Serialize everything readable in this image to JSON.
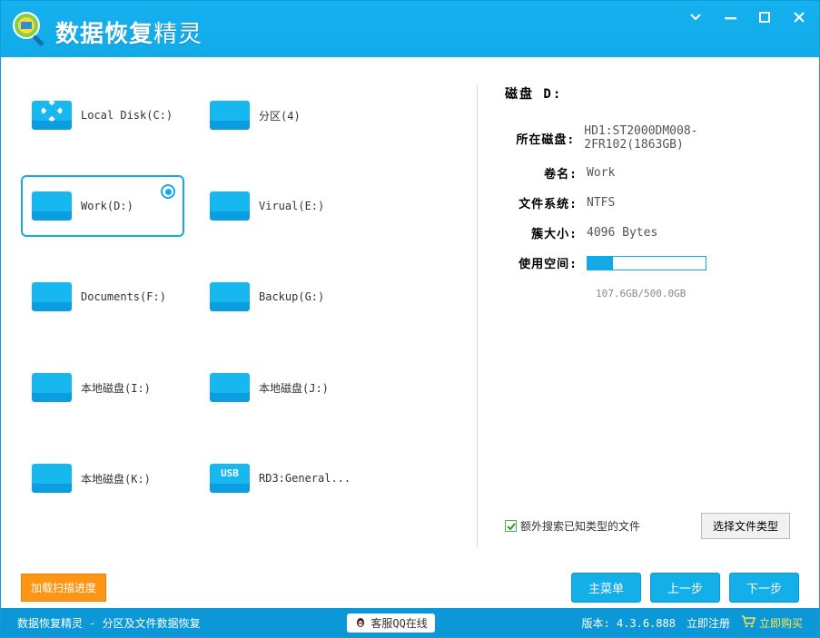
{
  "app_title_main": "数据恢复",
  "app_title_accent": "精灵",
  "disks": [
    {
      "label": "Local Disk(C:)",
      "kind": "system",
      "selected": false
    },
    {
      "label": "分区(4)",
      "kind": "partition",
      "selected": false
    },
    {
      "label": "Work(D:)",
      "kind": "disk",
      "selected": true
    },
    {
      "label": "Virual(E:)",
      "kind": "disk",
      "selected": false
    },
    {
      "label": "Documents(F:)",
      "kind": "disk",
      "selected": false
    },
    {
      "label": "Backup(G:)",
      "kind": "disk",
      "selected": false
    },
    {
      "label": "本地磁盘(I:)",
      "kind": "disk",
      "selected": false
    },
    {
      "label": "本地磁盘(J:)",
      "kind": "disk",
      "selected": false
    },
    {
      "label": "本地磁盘(K:)",
      "kind": "disk",
      "selected": false
    },
    {
      "label": "RD3:General...",
      "kind": "usb",
      "selected": false
    }
  ],
  "details": {
    "title": "磁盘 D:",
    "rows": {
      "physical_disk": {
        "label": "所在磁盘:",
        "value": "HD1:ST2000DM008-2FR102(1863GB)"
      },
      "volume_name": {
        "label": "卷名:",
        "value": "Work"
      },
      "file_system": {
        "label": "文件系统:",
        "value": "NTFS"
      },
      "cluster_size": {
        "label": "簇大小:",
        "value": "4096 Bytes"
      },
      "used_space": {
        "label": "使用空间:"
      }
    },
    "usage": {
      "percent": 21.5,
      "text": "107.6GB/500.0GB"
    }
  },
  "options": {
    "extra_search_label": "额外搜索已知类型的文件",
    "select_type_button": "选择文件类型"
  },
  "actions": {
    "load_progress": "加载扫描进度",
    "main_menu": "主菜单",
    "prev": "上一步",
    "next": "下一步"
  },
  "status": {
    "left": "数据恢复精灵 - 分区及文件数据恢复",
    "qq": "客服QQ在线",
    "version_prefix": "版本: ",
    "version": "4.3.6.888",
    "register": "立即注册",
    "buy": "立即购买"
  }
}
